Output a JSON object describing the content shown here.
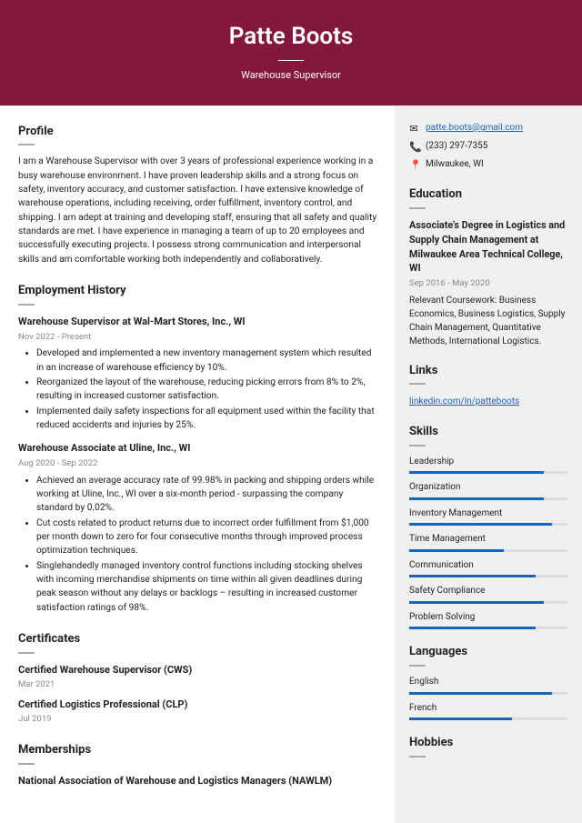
{
  "header": {
    "name": "Patte Boots",
    "title": "Warehouse Supervisor"
  },
  "profile": {
    "heading": "Profile",
    "text": "I am a Warehouse Supervisor with over 3 years of professional experience working in a busy warehouse environment. I have proven leadership skills and a strong focus on safety, inventory accuracy, and customer satisfaction. I have extensive knowledge of warehouse operations, including receiving, order fulfillment, inventory control, and shipping. I am adept at training and developing staff, ensuring that all safety and quality standards are met. I have experience in managing a team of up to 20 employees and successfully executing projects. I possess strong communication and interpersonal skills and am comfortable working both independently and collaboratively."
  },
  "employment": {
    "heading": "Employment History",
    "jobs": [
      {
        "title": "Warehouse Supervisor at Wal-Mart Stores, Inc., WI",
        "dates": "Nov 2022 - Present",
        "bullets": [
          "Developed and implemented a new inventory management system which resulted in an increase of warehouse efficiency by 10%.",
          "Reorganized the layout of the warehouse, reducing picking errors from 8% to 2%, resulting in increased customer satisfaction.",
          "Implemented daily safety inspections for all equipment used within the facility that reduced accidents and injuries by 25%."
        ]
      },
      {
        "title": "Warehouse Associate at Uline, Inc., WI",
        "dates": "Aug 2020 - Sep 2022",
        "bullets": [
          "Achieved an average accuracy rate of 99.98% in packing and shipping orders while working at Uline, Inc., WI over a six-month period - surpassing the company standard by 0.02%.",
          "Cut costs related to product returns due to incorrect order fulfillment from $1,000 per month down to zero for four consecutive months through improved process optimization techniques.",
          "Singlehandedly managed inventory control functions including stocking shelves with incoming merchandise shipments on time within all given deadlines during peak season without any delays or backlogs – resulting in increased customer satisfaction ratings of 98%."
        ]
      }
    ]
  },
  "certificates": {
    "heading": "Certificates",
    "items": [
      {
        "name": "Certified Warehouse Supervisor (CWS)",
        "date": "Mar 2021"
      },
      {
        "name": "Certified Logistics Professional (CLP)",
        "date": "Jul 2019"
      }
    ]
  },
  "memberships": {
    "heading": "Memberships",
    "items": [
      {
        "name": "National Association of Warehouse and Logistics Managers (NAWLM)"
      }
    ]
  },
  "contact": {
    "email": "patte.boots@gmail.com",
    "phone": "(233) 297-7355",
    "location": "Milwaukee, WI"
  },
  "education": {
    "heading": "Education",
    "title": "Associate's Degree in Logistics and Supply Chain Management at Milwaukee Area Technical College, WI",
    "dates": "Sep 2016 - May 2020",
    "body": "Relevant Coursework: Business Economics, Business Logistics, Supply Chain Management, Quantitative Methods, International Logistics."
  },
  "links": {
    "heading": "Links",
    "url": "linkedin.com/in/patteboots"
  },
  "skills": {
    "heading": "Skills",
    "items": [
      {
        "name": "Leadership",
        "pct": 85
      },
      {
        "name": "Organization",
        "pct": 85
      },
      {
        "name": "Inventory Management",
        "pct": 90
      },
      {
        "name": "Time Management",
        "pct": 60
      },
      {
        "name": "Communication",
        "pct": 80
      },
      {
        "name": "Safety Compliance",
        "pct": 85
      },
      {
        "name": "Problem Solving",
        "pct": 80
      }
    ]
  },
  "languages": {
    "heading": "Languages",
    "items": [
      {
        "name": "English",
        "pct": 90
      },
      {
        "name": "French",
        "pct": 65
      }
    ]
  },
  "hobbies": {
    "heading": "Hobbies"
  }
}
